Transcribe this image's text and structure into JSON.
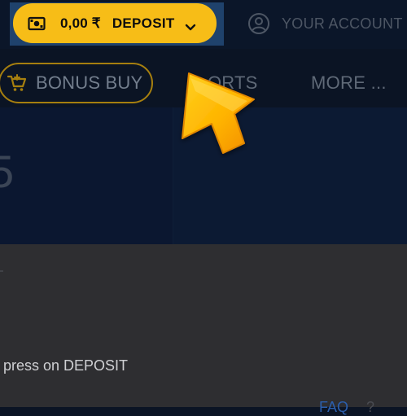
{
  "header": {
    "balance": "0,00 ₹",
    "deposit_label": "DEPOSIT",
    "account_label": "YOUR ACCOUNT",
    "wallet_icon": "wallet-icon",
    "chevron_icon": "chevron-down-icon",
    "user_icon": "user-circle-icon"
  },
  "nav": {
    "bonus_buy": "BONUS BUY",
    "sports_partial": "ORTS",
    "more": "MORE ..."
  },
  "hero": {
    "partial_digit": "5"
  },
  "content": {
    "instruction": "press on DEPOSIT",
    "faq_partial": "FAQ",
    "help_partial": "?"
  },
  "colors": {
    "accent": "#f7bd17",
    "background": "#0b1424",
    "link": "#2b5fae"
  }
}
